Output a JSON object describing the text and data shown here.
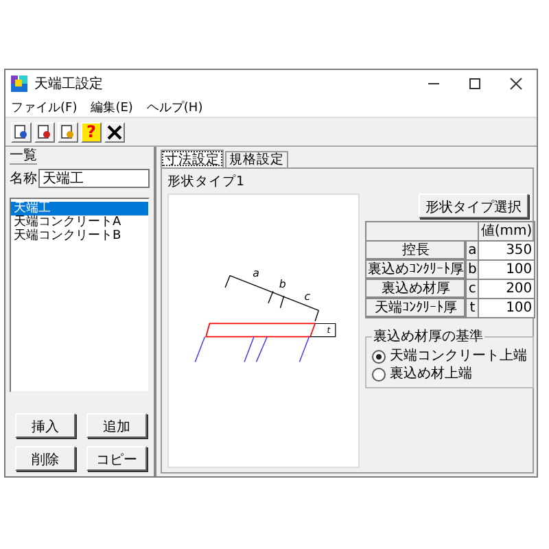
{
  "window": {
    "title": "天端工設定"
  },
  "menu": [
    "ファイル(F)",
    "編集(E)",
    "ヘルプ(H)"
  ],
  "toolbar": [
    {
      "kind": "search-doc"
    },
    {
      "kind": "edit-doc"
    },
    {
      "kind": "view-doc"
    },
    {
      "kind": "help",
      "glyph": "?"
    },
    {
      "kind": "delete"
    }
  ],
  "list_panel": {
    "title": "一覧",
    "name_label": "名称",
    "name_value": "天端工",
    "items": [
      {
        "label": "天端工",
        "selected": true
      },
      {
        "label": "天端コンクリートA",
        "selected": false
      },
      {
        "label": "天端コンクリートB",
        "selected": false
      }
    ],
    "buttons": [
      "挿入",
      "追加",
      "削除",
      "コピー"
    ]
  },
  "tabs": [
    {
      "label": "寸法設定",
      "selected": true
    },
    {
      "label": "規格設定",
      "selected": false
    }
  ],
  "shape": {
    "title": "形状タイプ1",
    "select_button": "形状タイプ選択",
    "diagram_labels": [
      "a",
      "b",
      "c",
      "t"
    ]
  },
  "dimensions": {
    "header": "値(mm)",
    "rows": [
      {
        "name": "控長",
        "symbol": "a",
        "value": "350"
      },
      {
        "name": "裏込めｺﾝｸﾘｰﾄ厚",
        "symbol": "b",
        "value": "100"
      },
      {
        "name": "裏込め材厚",
        "symbol": "c",
        "value": "200"
      },
      {
        "name": "天端ｺﾝｸﾘｰﾄ厚",
        "symbol": "t",
        "value": "100"
      }
    ]
  },
  "basis": {
    "title": "裏込め材厚の基準",
    "options": [
      {
        "label": "天端コンクリート上端",
        "selected": true
      },
      {
        "label": "裏込め材上端",
        "selected": false
      }
    ]
  }
}
